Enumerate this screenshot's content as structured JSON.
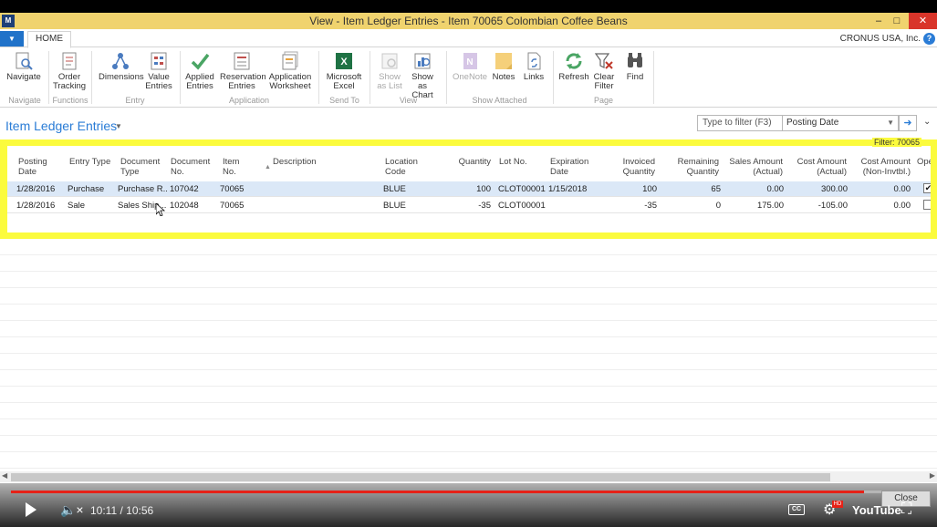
{
  "window": {
    "title": "View - Item Ledger Entries - Item 70065 Colombian Coffee Beans",
    "minimize": "–",
    "maximize": "□",
    "close": "✕"
  },
  "tabs": {
    "home": "HOME",
    "company": "CRONUS USA, Inc."
  },
  "ribbon": {
    "buttons": [
      {
        "label": "Navigate",
        "icon": "navigate-icon",
        "group": "Navigate"
      },
      {
        "label": "Order\nTracking",
        "icon": "order-tracking-icon",
        "group": "Functions"
      },
      {
        "label": "Dimensions",
        "icon": "dimensions-icon",
        "group": "Entry"
      },
      {
        "label": "Value\nEntries",
        "icon": "value-entries-icon",
        "group": "Entry"
      },
      {
        "label": "Applied\nEntries",
        "icon": "check-icon",
        "group": "Application"
      },
      {
        "label": "Reservation\nEntries",
        "icon": "reservation-icon",
        "group": "Application"
      },
      {
        "label": "Application\nWorksheet",
        "icon": "worksheet-icon",
        "group": "Application"
      },
      {
        "label": "Microsoft\nExcel",
        "icon": "excel-icon",
        "group": "Send To"
      },
      {
        "label": "Show\nas List",
        "icon": "list-icon",
        "group": "View"
      },
      {
        "label": "Show as\nChart",
        "icon": "chart-icon",
        "group": "View"
      },
      {
        "label": "OneNote",
        "icon": "onenote-icon",
        "group": "Show Attached"
      },
      {
        "label": "Notes",
        "icon": "notes-icon",
        "group": "Show Attached"
      },
      {
        "label": "Links",
        "icon": "links-icon",
        "group": "Show Attached"
      },
      {
        "label": "Refresh",
        "icon": "refresh-icon",
        "group": "Page"
      },
      {
        "label": "Clear\nFilter",
        "icon": "clear-filter-icon",
        "group": "Page"
      },
      {
        "label": "Find",
        "icon": "find-icon",
        "group": "Page"
      }
    ],
    "groups": [
      "Navigate",
      "Functions",
      "Entry",
      "Application",
      "Send To",
      "View",
      "Show Attached",
      "Page"
    ]
  },
  "page": {
    "title": "Item Ledger Entries",
    "filter_placeholder": "Type to filter (F3)",
    "filter_field": "Posting Date",
    "filter_status": "Filter: 70065"
  },
  "grid": {
    "columns": [
      "Posting\nDate",
      "Entry Type",
      "Document\nType",
      "Document\nNo.",
      "Item\nNo.",
      "Description",
      "Location\nCode",
      "Quantity",
      "Lot No.",
      "Expiration\nDate",
      "Invoiced\nQuantity",
      "Remaining\nQuantity",
      "Sales Amount\n(Actual)",
      "Cost Amount\n(Actual)",
      "Cost Amount\n(Non-Invtbl.)",
      "Open"
    ],
    "rows": [
      {
        "posting_date": "1/28/2016",
        "entry_type": "Purchase",
        "document_type": "Purchase R...",
        "document_no": "107042",
        "item_no": "70065",
        "description": "",
        "location_code": "BLUE",
        "quantity": "100",
        "lot_no": "CLOT00001",
        "expiration_date": "1/15/2018",
        "invoiced_quantity": "100",
        "remaining_quantity": "65",
        "sales_amount": "0.00",
        "cost_amount": "300.00",
        "cost_amount_non_invtbl": "0.00",
        "open": "✔"
      },
      {
        "posting_date": "1/28/2016",
        "entry_type": "Sale",
        "document_type": "Sales Ship...",
        "document_no": "102048",
        "item_no": "70065",
        "description": "",
        "location_code": "BLUE",
        "quantity": "-35",
        "lot_no": "CLOT00001",
        "expiration_date": "",
        "invoiced_quantity": "-35",
        "remaining_quantity": "0",
        "sales_amount": "175.00",
        "cost_amount": "-105.00",
        "cost_amount_non_invtbl": "0.00",
        "open": ""
      }
    ]
  },
  "video": {
    "time": "10:11 / 10:56",
    "progress": 0.932,
    "close_label": "Close",
    "cc": "CC",
    "hd": "HD",
    "logo": "YouTube"
  }
}
